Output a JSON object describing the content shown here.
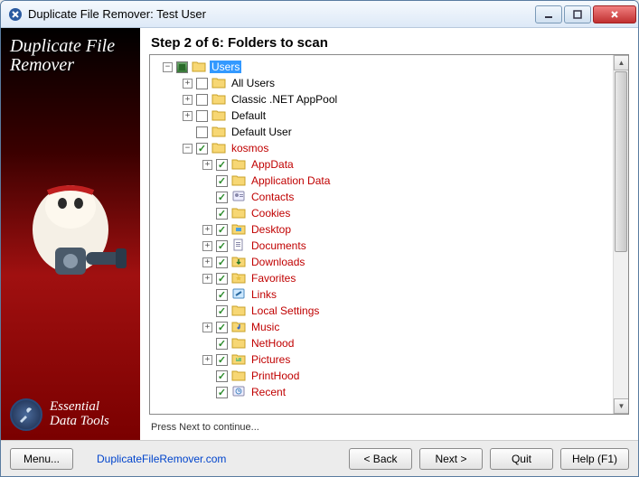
{
  "window": {
    "title": "Duplicate File Remover: Test User"
  },
  "sidebar": {
    "product_name_line1": "Duplicate File",
    "product_name_line2": "Remover",
    "footer_line1": "Essential",
    "footer_line2": "Data Tools"
  },
  "step": {
    "title": "Step 2 of 6: Folders to scan"
  },
  "tree": [
    {
      "depth": 0,
      "expander": "-",
      "check": "partial",
      "icon": "folder",
      "label": "Users",
      "selected": true,
      "red": false
    },
    {
      "depth": 1,
      "expander": "+",
      "check": "unchecked",
      "icon": "folder",
      "label": "All Users",
      "red": false
    },
    {
      "depth": 1,
      "expander": "+",
      "check": "unchecked",
      "icon": "folder",
      "label": "Classic .NET AppPool",
      "red": false
    },
    {
      "depth": 1,
      "expander": "+",
      "check": "unchecked",
      "icon": "folder",
      "label": "Default",
      "red": false
    },
    {
      "depth": 1,
      "expander": "",
      "check": "unchecked",
      "icon": "folder",
      "label": "Default User",
      "red": false
    },
    {
      "depth": 1,
      "expander": "-",
      "check": "checked",
      "icon": "folder",
      "label": "kosmos",
      "red": true
    },
    {
      "depth": 2,
      "expander": "+",
      "check": "checked",
      "icon": "folder",
      "label": "AppData",
      "red": true
    },
    {
      "depth": 2,
      "expander": "",
      "check": "checked",
      "icon": "folder",
      "label": "Application Data",
      "red": true
    },
    {
      "depth": 2,
      "expander": "",
      "check": "checked",
      "icon": "contacts",
      "label": "Contacts",
      "red": true
    },
    {
      "depth": 2,
      "expander": "",
      "check": "checked",
      "icon": "folder",
      "label": "Cookies",
      "red": true
    },
    {
      "depth": 2,
      "expander": "+",
      "check": "checked",
      "icon": "desktop",
      "label": "Desktop",
      "red": true
    },
    {
      "depth": 2,
      "expander": "+",
      "check": "checked",
      "icon": "documents",
      "label": "Documents",
      "red": true
    },
    {
      "depth": 2,
      "expander": "+",
      "check": "checked",
      "icon": "downloads",
      "label": "Downloads",
      "red": true
    },
    {
      "depth": 2,
      "expander": "+",
      "check": "checked",
      "icon": "favorites",
      "label": "Favorites",
      "red": true
    },
    {
      "depth": 2,
      "expander": "",
      "check": "checked",
      "icon": "links",
      "label": "Links",
      "red": true
    },
    {
      "depth": 2,
      "expander": "",
      "check": "checked",
      "icon": "folder",
      "label": "Local Settings",
      "red": true
    },
    {
      "depth": 2,
      "expander": "+",
      "check": "checked",
      "icon": "music",
      "label": "Music",
      "red": true
    },
    {
      "depth": 2,
      "expander": "",
      "check": "checked",
      "icon": "folder",
      "label": "NetHood",
      "red": true
    },
    {
      "depth": 2,
      "expander": "+",
      "check": "checked",
      "icon": "pictures",
      "label": "Pictures",
      "red": true
    },
    {
      "depth": 2,
      "expander": "",
      "check": "checked",
      "icon": "folder",
      "label": "PrintHood",
      "red": true
    },
    {
      "depth": 2,
      "expander": "",
      "check": "checked",
      "icon": "recent",
      "label": "Recent",
      "red": true
    }
  ],
  "hint": "Press Next to continue...",
  "footer": {
    "menu": "Menu...",
    "link": "DuplicateFileRemover.com",
    "back": "< Back",
    "next": "Next >",
    "quit": "Quit",
    "help": "Help (F1)"
  }
}
